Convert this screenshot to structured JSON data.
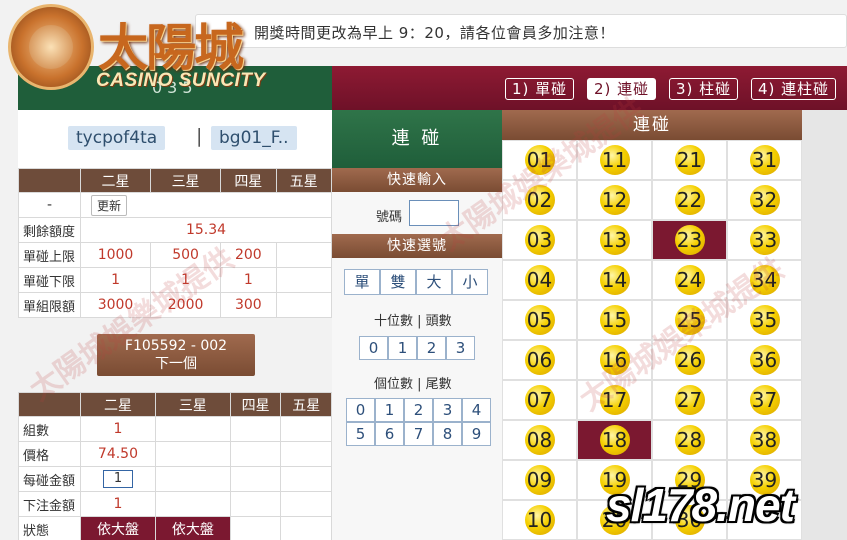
{
  "notice": {
    "text": "開獎時間更改為早上 9：20，請各位會員多加注意！"
  },
  "logo": {
    "cn": "太陽城",
    "en": "CASINO SUNCITY"
  },
  "header_num": "035",
  "tabs": [
    {
      "label": "1) 單碰",
      "active": false
    },
    {
      "label": "2) 連碰",
      "active": true
    },
    {
      "label": "3) 柱碰",
      "active": false
    },
    {
      "label": "4) 連柱碰",
      "active": false
    }
  ],
  "user": {
    "account": "tycpof4ta",
    "separator": "|",
    "sub": "bg01_F.."
  },
  "limits": {
    "headers": [
      "二星",
      "三星",
      "四星",
      "五星"
    ],
    "update_label": "更新",
    "dash": "-",
    "rows": [
      {
        "label": "剩餘額度",
        "values": [
          "15.34"
        ]
      },
      {
        "label": "單碰上限",
        "values": [
          "1000",
          "500",
          "200",
          ""
        ]
      },
      {
        "label": "單碰下限",
        "values": [
          "1",
          "1",
          "1",
          ""
        ]
      },
      {
        "label": "單組限額",
        "values": [
          "3000",
          "2000",
          "300",
          ""
        ]
      }
    ]
  },
  "next": {
    "code": "F105592 - 002",
    "label": "下一個"
  },
  "order": {
    "headers": [
      "二星",
      "三星",
      "四星",
      "五星"
    ],
    "group_label": "組數",
    "group_value": "1",
    "price_label": "價格",
    "price_value": "74.50",
    "amount_label": "每碰金額",
    "amount_value": "1",
    "bet_label": "下注金額",
    "bet_value": "1",
    "status_label": "狀態",
    "status_values": [
      "依大盤",
      "依大盤"
    ]
  },
  "middle": {
    "title": "連 碰",
    "quick_input": "快速輸入",
    "number_label": "號碼",
    "quick_select": "快速選號",
    "parity_buttons": [
      "單",
      "雙",
      "大",
      "小"
    ],
    "tens_label": "十位數 | 頭數",
    "tens_buttons": [
      "0",
      "1",
      "2",
      "3"
    ],
    "units_label": "個位數 | 尾數",
    "units_buttons_row1": [
      "0",
      "1",
      "2",
      "3",
      "4"
    ],
    "units_buttons_row2": [
      "5",
      "6",
      "7",
      "8",
      "9"
    ]
  },
  "grid": {
    "title": "連碰",
    "numbers": [
      "01",
      "11",
      "21",
      "31",
      "02",
      "12",
      "22",
      "32",
      "03",
      "13",
      "23",
      "33",
      "04",
      "14",
      "24",
      "34",
      "05",
      "15",
      "25",
      "35",
      "06",
      "16",
      "26",
      "36",
      "07",
      "17",
      "27",
      "37",
      "08",
      "18",
      "28",
      "38",
      "09",
      "19",
      "29",
      "39",
      "10",
      "20",
      "30",
      ""
    ],
    "selected": [
      "23",
      "18"
    ]
  },
  "watermark": {
    "text": "太陽城娛樂城提供",
    "site": "sl178.net"
  }
}
